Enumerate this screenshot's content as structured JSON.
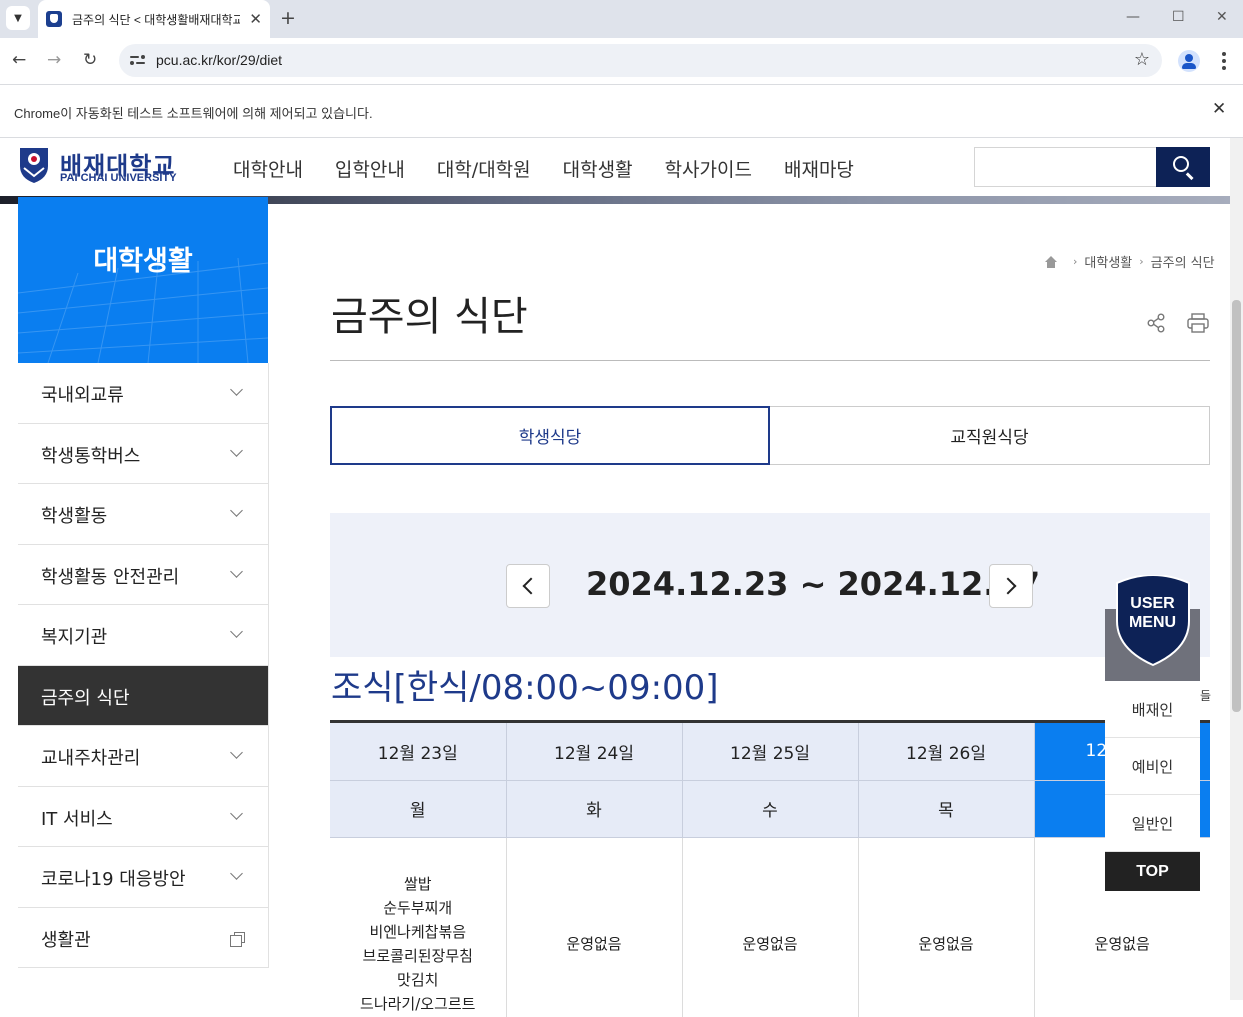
{
  "browser": {
    "tab_title": "금주의 식단 < 대학생활배재대학교",
    "url": "pcu.ac.kr/kor/29/diet",
    "infobar_text": "Chrome이 자동화된 테스트 소프트웨어에 의해 제어되고 있습니다.",
    "icons": [
      "tab-search-icon",
      "close-icon",
      "new-tab-icon",
      "minimize-icon",
      "maximize-icon",
      "back-icon",
      "forward-icon",
      "reload-icon",
      "site-info-icon",
      "bookmark-star-icon",
      "profile-icon",
      "kebab-menu-icon"
    ]
  },
  "header": {
    "logo_ko": "배재대학교",
    "logo_en": "PAI CHAI UNIVERSITY",
    "gnb": [
      "대학안내",
      "입학안내",
      "대학/대학원",
      "대학생활",
      "학사가이드",
      "배재마당"
    ],
    "search_placeholder": ""
  },
  "sidebar": {
    "title": "대학생활",
    "items": [
      {
        "label": "국내외교류",
        "icon": "chevron-down-icon"
      },
      {
        "label": "학생통학버스",
        "icon": "chevron-down-icon"
      },
      {
        "label": "학생활동",
        "icon": "chevron-down-icon"
      },
      {
        "label": "학생활동 안전관리",
        "icon": "chevron-down-icon"
      },
      {
        "label": "복지기관",
        "icon": "chevron-down-icon"
      },
      {
        "label": "금주의 식단",
        "active": true
      },
      {
        "label": "교내주차관리",
        "icon": "chevron-down-icon"
      },
      {
        "label": "IT 서비스",
        "icon": "chevron-down-icon"
      },
      {
        "label": "코로나19 대응방안",
        "icon": "chevron-down-icon"
      },
      {
        "label": "생활관",
        "icon": "new-window-icon"
      }
    ]
  },
  "breadcrumb": [
    "대학생활",
    "금주의 식단"
  ],
  "page": {
    "title": "금주의 식단",
    "tabs": [
      {
        "label": "학생식당",
        "active": true
      },
      {
        "label": "교직원식당",
        "active": false
      }
    ],
    "week_range": "2024.12.23 ~ 2024.12.27",
    "meal_heading": "조식[한식/08:00~09:00]",
    "table": {
      "dates": [
        "12월 23일",
        "12월 24일",
        "12월 25일",
        "12월 26일",
        "12"
      ],
      "weekdays": [
        "월",
        "화",
        "수",
        "목",
        ""
      ],
      "today_index": 4,
      "mon_menu": [
        "쌀밥",
        "순두부찌개",
        "비엔나케찹볶음",
        "브로콜리된장무침",
        "맛김치",
        "드나라기/오그르트"
      ],
      "no_service": "운영없음"
    }
  },
  "user_menu": {
    "title_line1": "USER",
    "title_line2": "MENU",
    "items": [
      "배재인",
      "예비인",
      "일반인"
    ],
    "top_label": "TOP",
    "peek_text": "들"
  },
  "colors": {
    "brand_navy": "#1e3a8a",
    "brand_blue": "#0a7ef0",
    "active_nav": "#333333",
    "search_button": "#0d2256"
  }
}
